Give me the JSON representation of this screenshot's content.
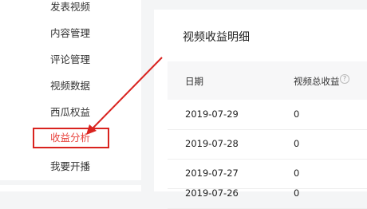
{
  "sidebar": {
    "items": [
      {
        "label": "发表视频"
      },
      {
        "label": "内容管理"
      },
      {
        "label": "评论管理"
      },
      {
        "label": "视频数据"
      },
      {
        "label": "西瓜权益"
      },
      {
        "label": "收益分析"
      },
      {
        "label": "我要开播"
      }
    ]
  },
  "main": {
    "title": "视频收益明细",
    "columns": [
      "日期",
      "视频总收益"
    ],
    "info_icon": "?",
    "rows": [
      {
        "date": "2019-07-29",
        "value": "0"
      },
      {
        "date": "2019-07-28",
        "value": "0"
      },
      {
        "date": "2019-07-27",
        "value": "0"
      },
      {
        "date": "2019-07-26",
        "value": "0"
      }
    ]
  },
  "colors": {
    "accent": "#e8423d",
    "annotation": "#d9231f"
  }
}
